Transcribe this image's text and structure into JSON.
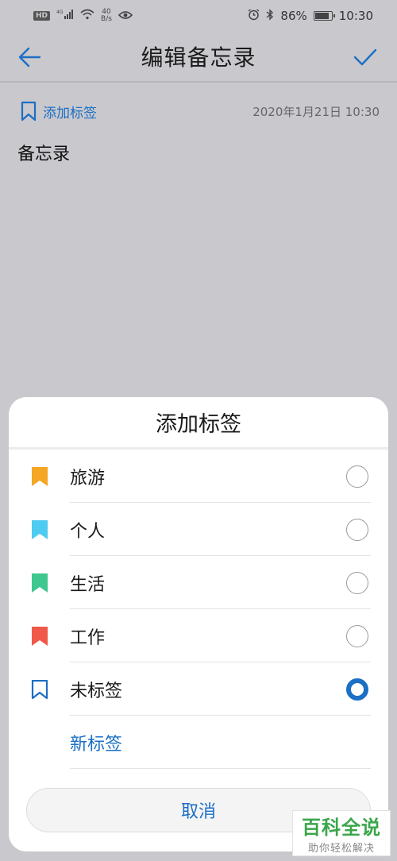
{
  "status_bar": {
    "hd_badge": "HD",
    "net_speed_value": "40",
    "net_speed_unit": "B/s",
    "battery_percent": 86,
    "battery_label": "86%",
    "time": "10:30",
    "icons": [
      "signal-4g-icon",
      "wifi-icon",
      "eye-icon",
      "alarm-icon",
      "bluetooth-icon",
      "battery-icon"
    ]
  },
  "header": {
    "title": "编辑备忘录",
    "back_icon": "arrow-left-icon",
    "confirm_icon": "check-icon"
  },
  "note": {
    "add_tag_label": "添加标签",
    "date": "2020年1月21日 10:30",
    "body": "备忘录"
  },
  "sheet": {
    "title": "添加标签",
    "tags": [
      {
        "label": "旅游",
        "color": "#f5a623",
        "selected": false
      },
      {
        "label": "个人",
        "color": "#4ecbf0",
        "selected": false
      },
      {
        "label": "生活",
        "color": "#3ec78f",
        "selected": false
      },
      {
        "label": "工作",
        "color": "#f0594a",
        "selected": false
      },
      {
        "label": "未标签",
        "color": "#1b6fc4",
        "selected": true
      }
    ],
    "new_tag_label": "新标签",
    "cancel_label": "取消"
  },
  "watermark": {
    "title": "百科全说",
    "subtitle": "助你轻松解决"
  },
  "colors": {
    "accent": "#1b6fc4",
    "background": "#c9c8cd",
    "watermark_green": "#3aa64a"
  }
}
